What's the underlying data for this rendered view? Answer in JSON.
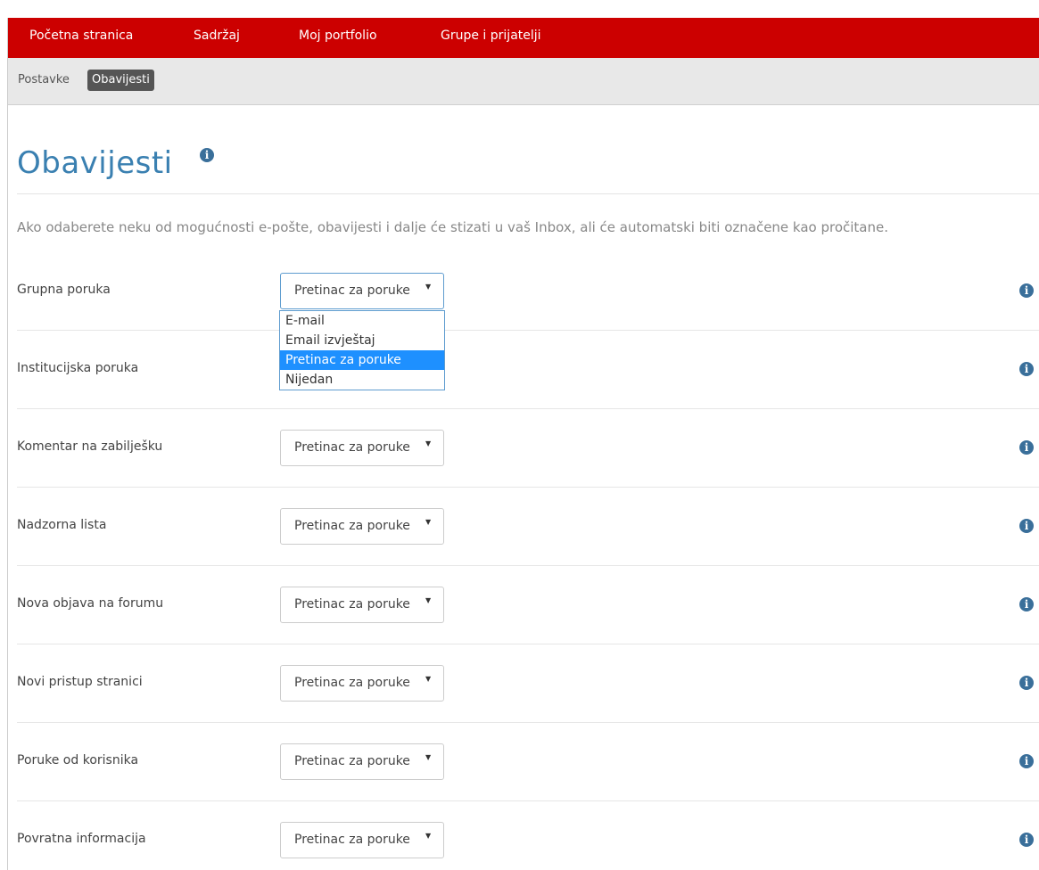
{
  "nav": {
    "items": [
      "Početna stranica",
      "Sadržaj",
      "Moj portfolio",
      "Grupe i prijatelji"
    ]
  },
  "subnav": {
    "breadcrumb": [
      "Postavke",
      "Obavijesti"
    ]
  },
  "page": {
    "title": "Obavijesti",
    "description": "Ako odaberete neku od mogućnosti e-pošte, obavijesti i dalje će stizati u vaš Inbox, ali će automatski biti označene kao pročitane."
  },
  "settings": {
    "rows": [
      {
        "label": "Grupna poruka",
        "value": "Pretinac za poruke"
      },
      {
        "label": "Institucijska poruka",
        "value": "Pretinac za poruke"
      },
      {
        "label": "Komentar na zabilješku",
        "value": "Pretinac za poruke"
      },
      {
        "label": "Nadzorna lista",
        "value": "Pretinac za poruke"
      },
      {
        "label": "Nova objava na forumu",
        "value": "Pretinac za poruke"
      },
      {
        "label": "Novi pristup stranici",
        "value": "Pretinac za poruke"
      },
      {
        "label": "Poruke od korisnika",
        "value": "Pretinac za poruke"
      },
      {
        "label": "Povratna informacija",
        "value": "Pretinac za poruke"
      }
    ]
  },
  "dropdown": {
    "options": [
      "E-mail",
      "Email izvještaj",
      "Pretinac za poruke",
      "Nijedan"
    ],
    "selected": "Pretinac za poruke"
  },
  "colors": {
    "nav_background": "#cc0000",
    "title": "#3a80b1",
    "info_icon": "#3a6f9a",
    "dropdown_selected": "#1e90ff"
  },
  "icons": {
    "info": "info-circle-icon",
    "caret": "caret-down-icon"
  }
}
